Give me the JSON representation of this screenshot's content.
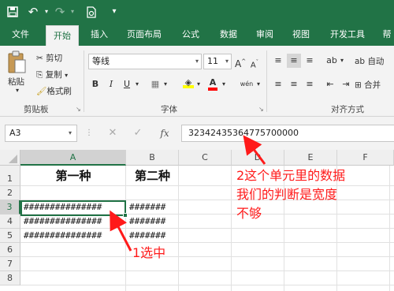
{
  "qat": {
    "save_icon": "save-icon",
    "undo_icon": "undo-icon",
    "redo_icon": "redo-icon",
    "print_preview_icon": "print-preview-icon",
    "customize_icon": "customize-icon"
  },
  "tabs": [
    "文件",
    "开始",
    "插入",
    "页面布局",
    "公式",
    "数据",
    "审阅",
    "视图",
    "开发工具",
    "帮"
  ],
  "active_tab": "开始",
  "ribbon": {
    "clipboard": {
      "paste": "粘贴",
      "cut": "剪切",
      "copy": "复制",
      "format_painter": "格式刷",
      "label": "剪贴板"
    },
    "font": {
      "font_name": "等线",
      "font_size": "11",
      "grow": "A",
      "shrink": "A",
      "bold": "B",
      "italic": "I",
      "underline": "U",
      "phonetic": "wén",
      "font_color_letter": "A",
      "fill_color": "#ffff00",
      "font_color": "#ff0000",
      "label": "字体"
    },
    "alignment": {
      "wrap": "自动",
      "merge": "合并",
      "label": "对齐方式"
    }
  },
  "formula_bar": {
    "name_box": "A3",
    "cancel": "✕",
    "enter": "✓",
    "fx": "fx",
    "value": "32342435364775700000"
  },
  "grid": {
    "columns": [
      "A",
      "B",
      "C",
      "D",
      "E",
      "F"
    ],
    "rows": [
      "1",
      "2",
      "3",
      "4",
      "5",
      "6",
      "7",
      "8"
    ],
    "selected_col": "A",
    "selected_row": "3",
    "cells": {
      "A1": "第一种",
      "B1": "第二种",
      "A3": "###############",
      "A4": "###############",
      "A5": "###############",
      "B3": "#######",
      "B4": "#######",
      "B5": "#######"
    }
  },
  "annotations": {
    "note_line1": "2这个单元里的数据",
    "note_line2": "我们的判断是宽度",
    "note_line3": "不够",
    "select_label": "1选中",
    "color": "#ff1a1a"
  }
}
